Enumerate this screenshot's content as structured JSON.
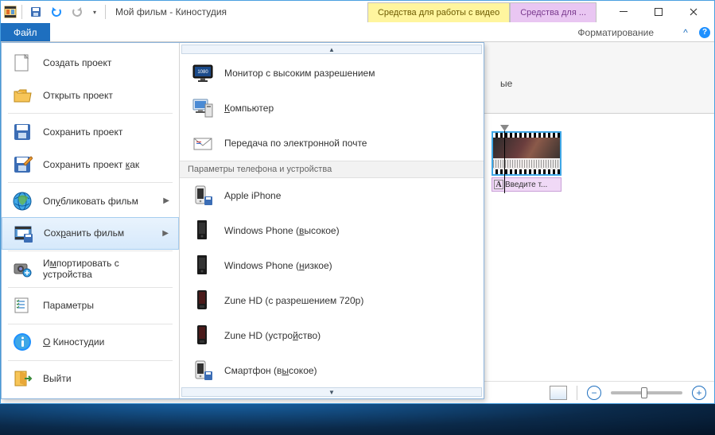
{
  "titlebar": {
    "title": "Мой фильм - Киностудия",
    "contextTabs": {
      "video": "Средства для работы с видео",
      "other": "Средства для ..."
    }
  },
  "ribbon": {
    "fileTab": "Файл",
    "formatTab": "Форматирование"
  },
  "misc": {
    "fragmentLabel": "ые",
    "captionText": "Введите т..."
  },
  "fileMenu": {
    "items": {
      "new": "Создать проект",
      "open": "Открыть проект",
      "save": "Сохранить проект",
      "saveAs_pre": "Сохранить проект ",
      "saveAs_u": "к",
      "saveAs_post": "ак",
      "publish_pre": "Оп",
      "publish_u": "у",
      "publish_post": "бликовать фильм",
      "saveMovie_pre": "Сох",
      "saveMovie_u": "р",
      "saveMovie_post": "анить фильм",
      "import_pre": "И",
      "import_u": "м",
      "import_post": "портировать с устройства",
      "options": "Параметры",
      "about_pre": "",
      "about_u": "О",
      "about_post": " Киностудии",
      "exit": "Выйти"
    }
  },
  "submenu": {
    "header": "Параметры телефона и устройства",
    "items": {
      "hdmonitor": "Монитор с высоким разрешением",
      "computer_u": "К",
      "computer_post": "омпьютер",
      "email": "Передача по электронной почте",
      "iphone": "Apple iPhone",
      "wp_high_pre": "Windows Phone (",
      "wp_high_u": "в",
      "wp_high_post": "ысокое)",
      "wp_low_pre": "Windows Phone (",
      "wp_low_u": "н",
      "wp_low_post": "изкое)",
      "zune720": "Zune HD (с разрешением 720p)",
      "zunedev_pre": "Zune HD (устро",
      "zunedev_u": "й",
      "zunedev_post": "ство)",
      "smart_pre": "Смартфон (в",
      "smart_u": "ы",
      "smart_post": "сокое)"
    }
  }
}
